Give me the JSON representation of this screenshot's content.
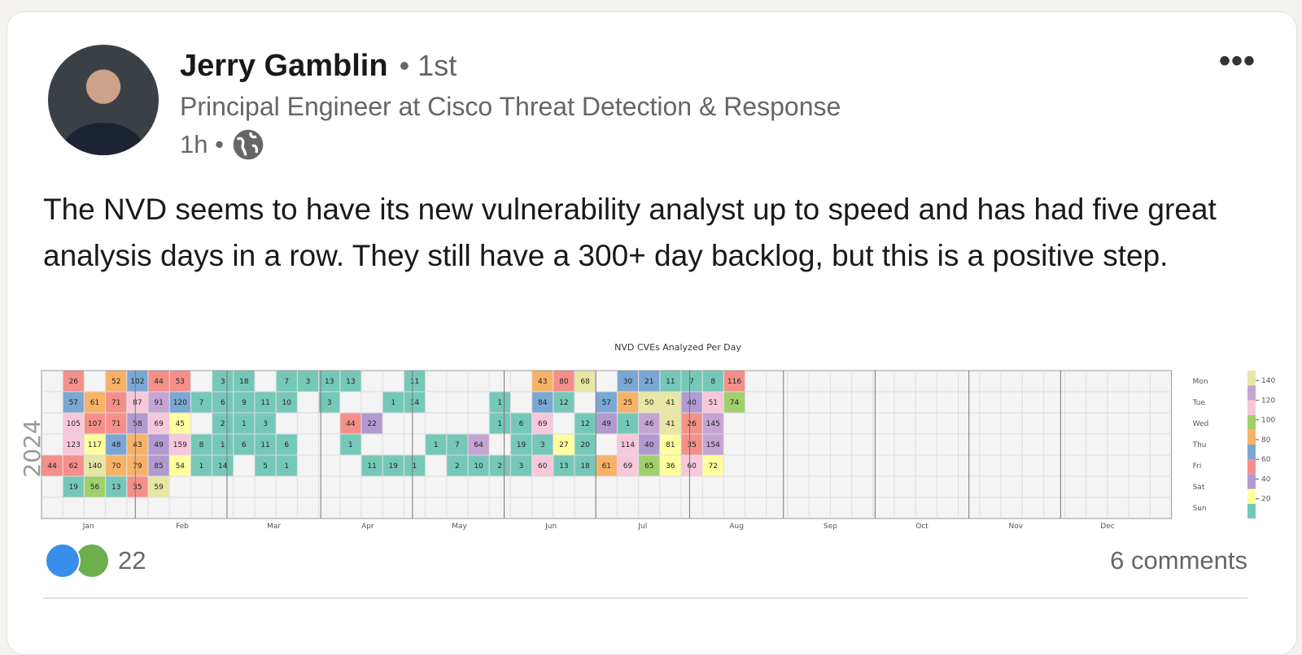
{
  "post": {
    "author_name": "Jerry Gamblin",
    "connection_degree": "• 1st",
    "headline": "Principal Engineer at Cisco Threat Detection & Response",
    "time": "1h •",
    "visibility_icon": "globe-icon",
    "more_icon": "•••",
    "text": "The NVD seems to have its new vulnerability analyst up to speed and has had five great analysis days in a row. They still have a 300+ day backlog, but this is a positive step.",
    "reaction_icons": [
      "like-icon",
      "celebrate-icon"
    ],
    "reaction_count": "22",
    "comments_label": "6 comments"
  },
  "chart_data": {
    "type": "heatmap",
    "title": "NVD CVEs Analyzed Per Day",
    "year_label": "2024",
    "row_labels": [
      "Mon",
      "Tue",
      "Wed",
      "Thu",
      "Fri",
      "Sat",
      "Sun"
    ],
    "month_labels": [
      "Jan",
      "Feb",
      "Mar",
      "Apr",
      "May",
      "Jun",
      "Jul",
      "Aug",
      "Sep",
      "Oct",
      "Nov",
      "Dec"
    ],
    "colorbar_ticks": [
      20,
      40,
      60,
      80,
      100,
      120,
      140
    ],
    "colorbar_colors": [
      "#75c8b8",
      "#ffff9d",
      "#b09ad0",
      "#f48f8a",
      "#7aa7d4",
      "#f8b268",
      "#a0d06c",
      "#f7c8dc",
      "#c5a4d2",
      "#e7e7a4"
    ],
    "grid": true,
    "legend": "right",
    "start_weekday": 0,
    "cells": [
      {
        "w": 0,
        "d": 4,
        "v": 44
      },
      {
        "w": 1,
        "d": 0,
        "v": 26
      },
      {
        "w": 1,
        "d": 1,
        "v": 57
      },
      {
        "w": 1,
        "d": 2,
        "v": 105
      },
      {
        "w": 1,
        "d": 3,
        "v": 123
      },
      {
        "w": 1,
        "d": 4,
        "v": 62
      },
      {
        "w": 1,
        "d": 5,
        "v": 19
      },
      {
        "w": 2,
        "d": 1,
        "v": 61
      },
      {
        "w": 2,
        "d": 2,
        "v": 107
      },
      {
        "w": 2,
        "d": 3,
        "v": 117
      },
      {
        "w": 2,
        "d": 4,
        "v": 140
      },
      {
        "w": 2,
        "d": 5,
        "v": 56
      },
      {
        "w": 3,
        "d": 0,
        "v": 52
      },
      {
        "w": 3,
        "d": 1,
        "v": 71
      },
      {
        "w": 3,
        "d": 2,
        "v": 71
      },
      {
        "w": 3,
        "d": 3,
        "v": 48
      },
      {
        "w": 3,
        "d": 4,
        "v": 70
      },
      {
        "w": 3,
        "d": 5,
        "v": 13
      },
      {
        "w": 4,
        "d": 0,
        "v": 102
      },
      {
        "w": 4,
        "d": 1,
        "v": 87
      },
      {
        "w": 4,
        "d": 2,
        "v": 58
      },
      {
        "w": 4,
        "d": 3,
        "v": 43
      },
      {
        "w": 4,
        "d": 4,
        "v": 79
      },
      {
        "w": 4,
        "d": 5,
        "v": 35
      },
      {
        "w": 5,
        "d": 0,
        "v": 44
      },
      {
        "w": 5,
        "d": 1,
        "v": 91
      },
      {
        "w": 5,
        "d": 2,
        "v": 69
      },
      {
        "w": 5,
        "d": 3,
        "v": 49
      },
      {
        "w": 5,
        "d": 4,
        "v": 85
      },
      {
        "w": 5,
        "d": 5,
        "v": 59
      },
      {
        "w": 6,
        "d": 0,
        "v": 53
      },
      {
        "w": 6,
        "d": 1,
        "v": 120
      },
      {
        "w": 6,
        "d": 2,
        "v": 45
      },
      {
        "w": 6,
        "d": 3,
        "v": 159
      },
      {
        "w": 6,
        "d": 4,
        "v": 54
      },
      {
        "w": 7,
        "d": 1,
        "v": 7
      },
      {
        "w": 7,
        "d": 3,
        "v": 8
      },
      {
        "w": 7,
        "d": 4,
        "v": 1
      },
      {
        "w": 8,
        "d": 0,
        "v": 3
      },
      {
        "w": 8,
        "d": 1,
        "v": 6
      },
      {
        "w": 8,
        "d": 2,
        "v": 2
      },
      {
        "w": 8,
        "d": 3,
        "v": 1
      },
      {
        "w": 8,
        "d": 4,
        "v": 14
      },
      {
        "w": 9,
        "d": 0,
        "v": 18
      },
      {
        "w": 9,
        "d": 1,
        "v": 9
      },
      {
        "w": 9,
        "d": 2,
        "v": 1
      },
      {
        "w": 9,
        "d": 3,
        "v": 6
      },
      {
        "w": 10,
        "d": 1,
        "v": 11
      },
      {
        "w": 10,
        "d": 2,
        "v": 3
      },
      {
        "w": 10,
        "d": 3,
        "v": 11
      },
      {
        "w": 10,
        "d": 4,
        "v": 5
      },
      {
        "w": 11,
        "d": 0,
        "v": 7
      },
      {
        "w": 11,
        "d": 1,
        "v": 10
      },
      {
        "w": 11,
        "d": 3,
        "v": 6
      },
      {
        "w": 11,
        "d": 4,
        "v": 1
      },
      {
        "w": 12,
        "d": 0,
        "v": 3
      },
      {
        "w": 13,
        "d": 0,
        "v": 13
      },
      {
        "w": 13,
        "d": 1,
        "v": 3
      },
      {
        "w": 14,
        "d": 0,
        "v": 13
      },
      {
        "w": 14,
        "d": 2,
        "v": 44
      },
      {
        "w": 14,
        "d": 3,
        "v": 1
      },
      {
        "w": 15,
        "d": 2,
        "v": 22
      },
      {
        "w": 15,
        "d": 4,
        "v": 11
      },
      {
        "w": 16,
        "d": 1,
        "v": 1
      },
      {
        "w": 16,
        "d": 4,
        "v": 19
      },
      {
        "w": 17,
        "d": 0,
        "v": 11
      },
      {
        "w": 17,
        "d": 1,
        "v": 14
      },
      {
        "w": 17,
        "d": 4,
        "v": 1
      },
      {
        "w": 18,
        "d": 3,
        "v": 1
      },
      {
        "w": 19,
        "d": 3,
        "v": 7
      },
      {
        "w": 19,
        "d": 4,
        "v": 2
      },
      {
        "w": 20,
        "d": 3,
        "v": 64
      },
      {
        "w": 20,
        "d": 4,
        "v": 10
      },
      {
        "w": 21,
        "d": 1,
        "v": 1
      },
      {
        "w": 21,
        "d": 2,
        "v": 1
      },
      {
        "w": 21,
        "d": 4,
        "v": 2
      },
      {
        "w": 22,
        "d": 2,
        "v": 6
      },
      {
        "w": 22,
        "d": 3,
        "v": 19
      },
      {
        "w": 22,
        "d": 4,
        "v": 3
      },
      {
        "w": 23,
        "d": 0,
        "v": 43
      },
      {
        "w": 23,
        "d": 1,
        "v": 84
      },
      {
        "w": 23,
        "d": 2,
        "v": 69
      },
      {
        "w": 23,
        "d": 3,
        "v": 3
      },
      {
        "w": 23,
        "d": 4,
        "v": 60
      },
      {
        "w": 24,
        "d": 0,
        "v": 80
      },
      {
        "w": 24,
        "d": 1,
        "v": 12
      },
      {
        "w": 24,
        "d": 3,
        "v": 27
      },
      {
        "w": 24,
        "d": 4,
        "v": 13
      },
      {
        "w": 25,
        "d": 0,
        "v": 68
      },
      {
        "w": 25,
        "d": 2,
        "v": 12
      },
      {
        "w": 25,
        "d": 3,
        "v": 20
      },
      {
        "w": 25,
        "d": 4,
        "v": 18
      },
      {
        "w": 26,
        "d": 1,
        "v": 57
      },
      {
        "w": 26,
        "d": 2,
        "v": 49
      },
      {
        "w": 26,
        "d": 4,
        "v": 61
      },
      {
        "w": 27,
        "d": 0,
        "v": 30
      },
      {
        "w": 27,
        "d": 1,
        "v": 25
      },
      {
        "w": 27,
        "d": 2,
        "v": 1
      },
      {
        "w": 27,
        "d": 3,
        "v": 114
      },
      {
        "w": 27,
        "d": 4,
        "v": 69
      },
      {
        "w": 28,
        "d": 0,
        "v": 21
      },
      {
        "w": 28,
        "d": 1,
        "v": 50
      },
      {
        "w": 28,
        "d": 2,
        "v": 46
      },
      {
        "w": 28,
        "d": 3,
        "v": 40
      },
      {
        "w": 28,
        "d": 4,
        "v": 65
      },
      {
        "w": 29,
        "d": 0,
        "v": 11
      },
      {
        "w": 29,
        "d": 1,
        "v": 41
      },
      {
        "w": 29,
        "d": 2,
        "v": 41
      },
      {
        "w": 29,
        "d": 3,
        "v": 81
      },
      {
        "w": 29,
        "d": 4,
        "v": 36
      },
      {
        "w": 30,
        "d": 0,
        "v": 7
      },
      {
        "w": 30,
        "d": 1,
        "v": 40
      },
      {
        "w": 30,
        "d": 2,
        "v": 26
      },
      {
        "w": 30,
        "d": 3,
        "v": 35
      },
      {
        "w": 30,
        "d": 4,
        "v": 60
      },
      {
        "w": 31,
        "d": 0,
        "v": 8
      },
      {
        "w": 31,
        "d": 1,
        "v": 51
      },
      {
        "w": 31,
        "d": 2,
        "v": 145
      },
      {
        "w": 31,
        "d": 3,
        "v": 154
      },
      {
        "w": 31,
        "d": 4,
        "v": 72
      },
      {
        "w": 32,
        "d": 0,
        "v": 116
      },
      {
        "w": 32,
        "d": 1,
        "v": 74
      }
    ]
  }
}
